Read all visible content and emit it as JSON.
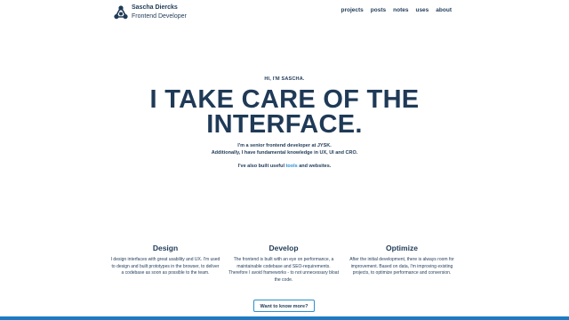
{
  "brand": {
    "name": "Sascha Diercks",
    "role": "Frontend Developer",
    "logo_icon": "triangle-circles-logo-icon"
  },
  "nav": {
    "items": [
      "projects",
      "posts",
      "notes",
      "uses",
      "about"
    ]
  },
  "hero": {
    "greeting": "HI, I'M SASCHA.",
    "headline_line1": "I TAKE CARE OF THE",
    "headline_line2": "INTERFACE.",
    "intro_line1": "I'm a senior frontend developer at JYSK.",
    "intro_line2": "Additionally, I have fundamental knowledge in UX, UI and CRO.",
    "built_prefix": "I've also built useful",
    "built_link": "tools",
    "built_suffix": "and websites."
  },
  "features": [
    {
      "title": "Design",
      "text": "I design interfaces with great usability and UX. I'm used to design and built prototypes in the browser, to deliver a codebase as soon as possible to the team."
    },
    {
      "title": "Develop",
      "text": "The frontend is built with an eye on performance, a maintainable codebase and SEO-requirements. Therefore I avoid frameworks - to not unnecessary bloat the code."
    },
    {
      "title": "Optimize",
      "text": "After the initial development, there is always room for improvement. Based on data, I'm improving existing projects, to optimize performance and conversion."
    }
  ],
  "cta": {
    "label": "Want to know more?"
  },
  "colors": {
    "text": "#1f3a57",
    "accent": "#2d8fcf",
    "bar": "#1d7bc3"
  }
}
